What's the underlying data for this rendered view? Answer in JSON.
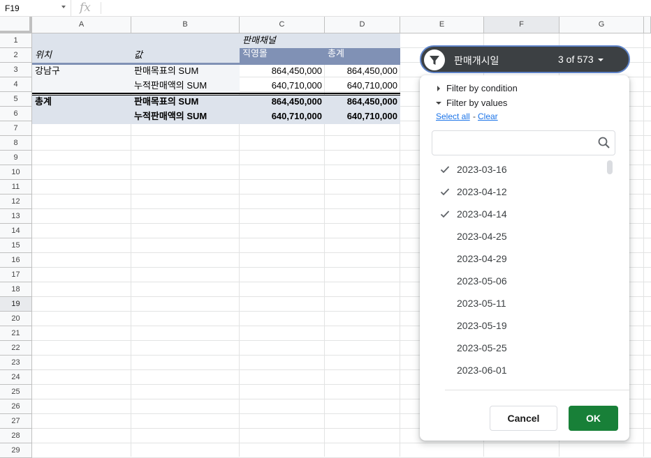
{
  "formula_bar": {
    "cell_ref": "F19",
    "fx": "fx"
  },
  "columns": [
    "A",
    "B",
    "C",
    "D",
    "E",
    "F",
    "G"
  ],
  "rows": [
    "1",
    "2",
    "3",
    "4",
    "5",
    "6",
    "7",
    "8",
    "9",
    "10",
    "11",
    "12",
    "13",
    "14",
    "15",
    "16",
    "17",
    "18",
    "19",
    "20",
    "21",
    "22",
    "23",
    "24",
    "25",
    "26",
    "27",
    "28",
    "29"
  ],
  "selected_row": "19",
  "selected_col": "F",
  "pivot": {
    "channel_header": "판매채널",
    "row_header_location": "위치",
    "row_header_values": "값",
    "col_direct": "직영몰",
    "col_total": "총계",
    "rows": [
      {
        "location": "강남구",
        "value_label": "판매목표의 SUM",
        "direct": "864,450,000",
        "total": "864,450,000"
      },
      {
        "location": "",
        "value_label": "누적판매액의 SUM",
        "direct": "640,710,000",
        "total": "640,710,000"
      }
    ],
    "grand_total_label": "총계",
    "grand_rows": [
      {
        "value_label": "판매목표의 SUM",
        "direct": "864,450,000",
        "total": "864,450,000"
      },
      {
        "value_label": "누적판매액의 SUM",
        "direct": "640,710,000",
        "total": "640,710,000"
      }
    ],
    "colors": {
      "header_band": "#dde3ec",
      "header_dark": "#8091b5"
    }
  },
  "filter": {
    "field_name": "판매개시일",
    "count": "3 of 573",
    "by_condition": "Filter by condition",
    "by_values": "Filter by values",
    "select_all": "Select all",
    "separator": "-",
    "clear": "Clear",
    "search_value": "",
    "items": [
      {
        "label": "2023-03-16",
        "checked": true
      },
      {
        "label": "2023-04-12",
        "checked": true
      },
      {
        "label": "2023-04-14",
        "checked": true
      },
      {
        "label": "2023-04-25",
        "checked": false
      },
      {
        "label": "2023-04-29",
        "checked": false
      },
      {
        "label": "2023-05-06",
        "checked": false
      },
      {
        "label": "2023-05-11",
        "checked": false
      },
      {
        "label": "2023-05-19",
        "checked": false
      },
      {
        "label": "2023-05-25",
        "checked": false
      },
      {
        "label": "2023-06-01",
        "checked": false
      }
    ],
    "cancel_label": "Cancel",
    "ok_label": "OK",
    "colors": {
      "ok": "#188038",
      "chip": "#3c4043",
      "link": "#1a73e8"
    }
  }
}
